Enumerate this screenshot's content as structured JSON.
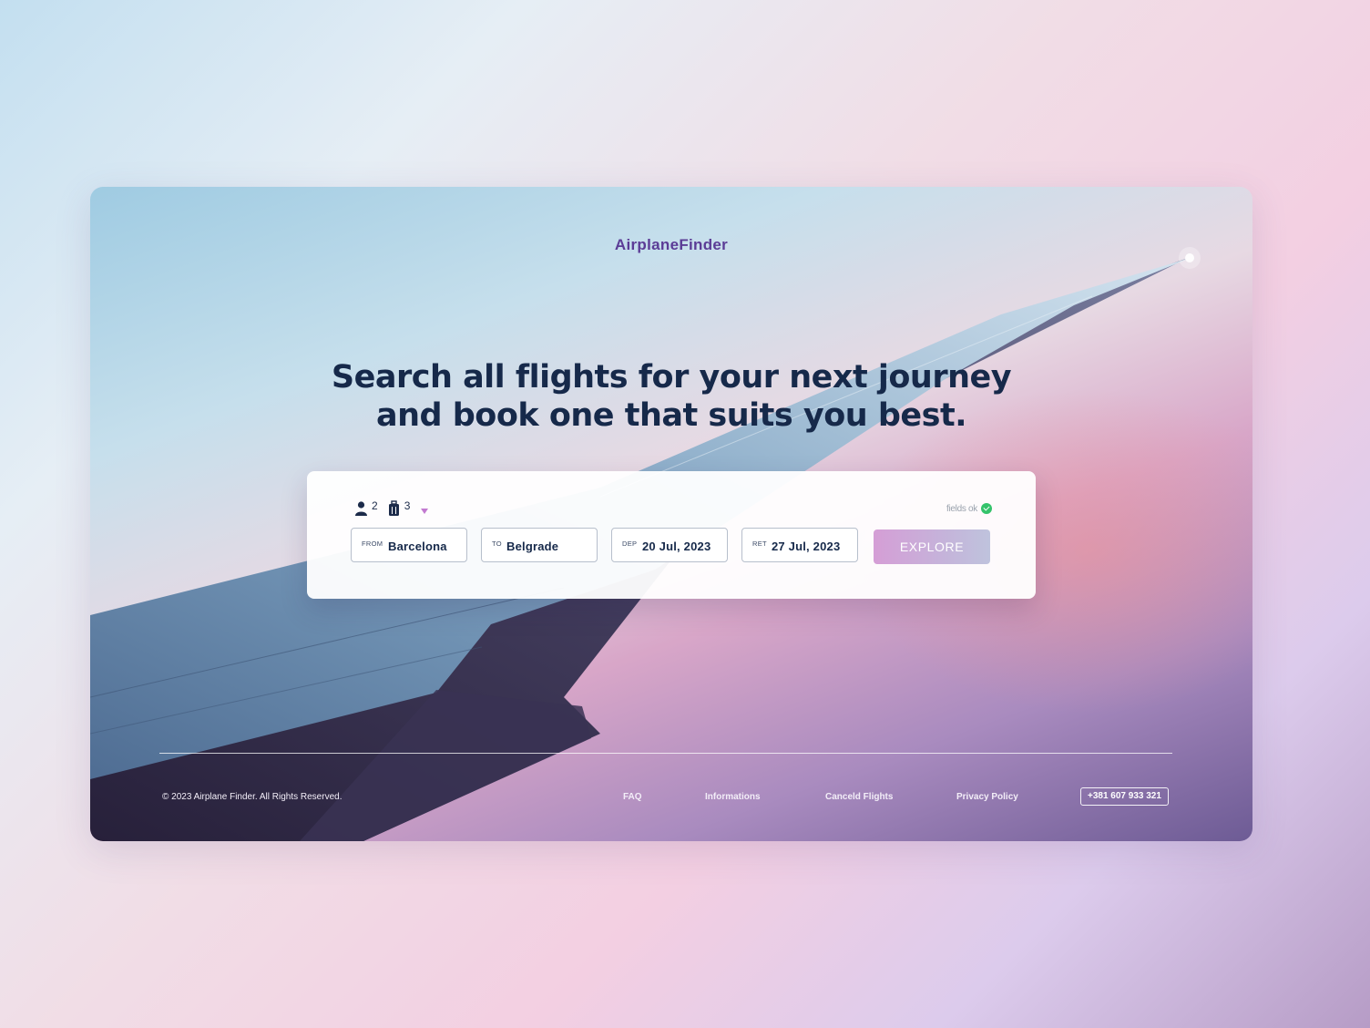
{
  "brand": {
    "name": "AirplaneFinder"
  },
  "hero": {
    "line1": "Search all flights for your next journey",
    "line2": "and book one that suits you best."
  },
  "search": {
    "passengers_icon": "person-icon",
    "passengers": "2",
    "bags_icon": "luggage-icon",
    "bags": "3",
    "status_text": "fields ok",
    "status_icon": "check-circle-icon",
    "from": {
      "label": "FROM",
      "value": "Barcelona"
    },
    "to": {
      "label": "TO",
      "value": "Belgrade"
    },
    "dep": {
      "label": "DEP",
      "value": "20 Jul, 2023"
    },
    "ret": {
      "label": "RET",
      "value": "27 Jul, 2023"
    },
    "explore_label": "EXPLORE"
  },
  "footer": {
    "copyright": "© 2023 Airplane Finder. All Rights Reserved.",
    "links": [
      "FAQ",
      "Informations",
      "Canceld Flights",
      "Privacy Policy"
    ],
    "phone": "+381 607 933 321"
  },
  "colors": {
    "brand": "#5b3c96",
    "heading": "#16294a",
    "accent": "#d59ed6",
    "success": "#34c36b"
  }
}
